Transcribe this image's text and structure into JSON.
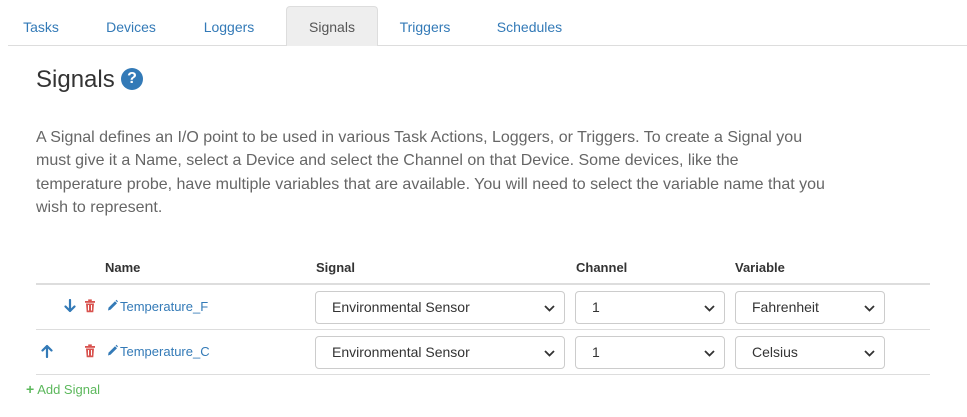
{
  "tabs": [
    {
      "label": "Tasks",
      "active": false
    },
    {
      "label": "Devices",
      "active": false
    },
    {
      "label": "Loggers",
      "active": false
    },
    {
      "label": "Signals",
      "active": true
    },
    {
      "label": "Triggers",
      "active": false
    },
    {
      "label": "Schedules",
      "active": false
    }
  ],
  "page": {
    "title": "Signals",
    "help_glyph": "?",
    "description": "A Signal defines an I/O point to be used in various Task Actions, Loggers, or Triggers. To create a Signal you must give it a Name, select a Device and select the Channel on that Device. Some devices, like the temperature probe, have multiple variables that are available. You will need to select the variable name that you wish to represent."
  },
  "table": {
    "headers": {
      "name": "Name",
      "signal": "Signal",
      "channel": "Channel",
      "variable": "Variable"
    },
    "rows": [
      {
        "arrow": "arrow-down-icon",
        "name": "Temperature_F",
        "signal": "Environmental Sensor",
        "channel": "1",
        "variable": "Fahrenheit"
      },
      {
        "arrow": "arrow-up-icon",
        "name": "Temperature_C",
        "signal": "Environmental Sensor",
        "channel": "1",
        "variable": "Celsius"
      }
    ]
  },
  "actions": {
    "add_signal_label": "Add Signal",
    "add_glyph": "+"
  },
  "colors": {
    "link": "#337ab7",
    "delete": "#d9534f",
    "add": "#5cb85c",
    "text_muted": "#666666"
  }
}
